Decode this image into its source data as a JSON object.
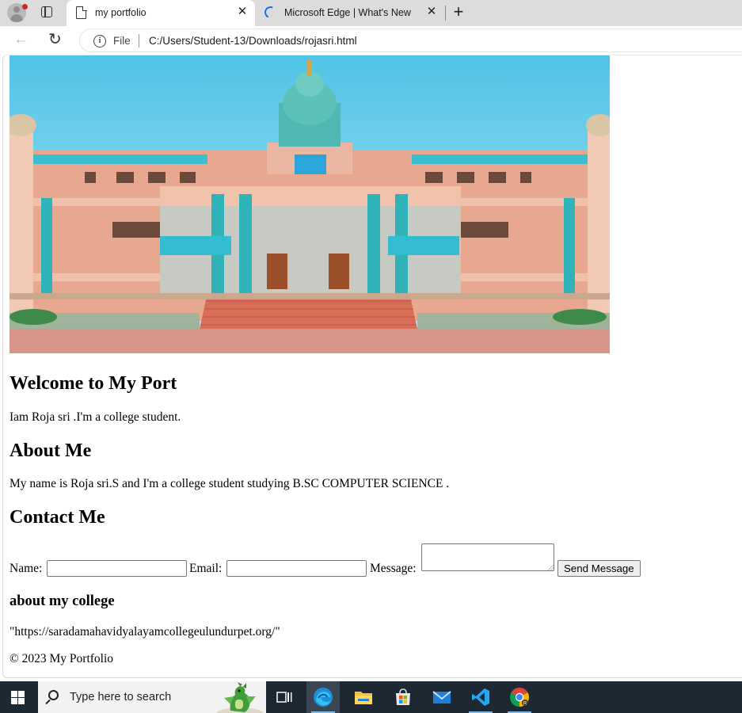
{
  "browser": {
    "tabs": [
      {
        "title": "my portfolio",
        "active": true
      },
      {
        "title": "Microsoft Edge | What's New",
        "active": false,
        "loading": true
      }
    ],
    "address": {
      "site_label": "File",
      "url": "C:/Users/Student-13/Downloads/rojasri.html"
    }
  },
  "page": {
    "welcome_heading": "Welcome to My Port",
    "intro": "Iam Roja sri .I'm a college student.",
    "about_heading": "About Me",
    "about_text": "My name is Roja sri.S and I'm a college student studying B.SC COMPUTER SCIENCE .",
    "contact_heading": "Contact Me",
    "form": {
      "name_label": "Name:",
      "email_label": "Email:",
      "message_label": "Message:",
      "name_value": "",
      "email_value": "",
      "message_value": "",
      "submit_label": "Send Message"
    },
    "college_heading": "about my college",
    "college_link": "\"https://saradamahavidyalayamcollegeulundurpet.org/\"",
    "footer": "© 2023 My Portfolio"
  },
  "taskbar": {
    "search_placeholder": "Type here to search",
    "icons": [
      "start-icon",
      "task-view-icon",
      "edge-icon",
      "file-explorer-icon",
      "microsoft-store-icon",
      "mail-icon",
      "vscode-icon",
      "chrome-icon"
    ]
  },
  "colors": {
    "tab_strip": "#dcdcdc",
    "taskbar": "#1d2833",
    "edge_blue": "#1e6fd4",
    "vscode_blue": "#23a9f2"
  }
}
